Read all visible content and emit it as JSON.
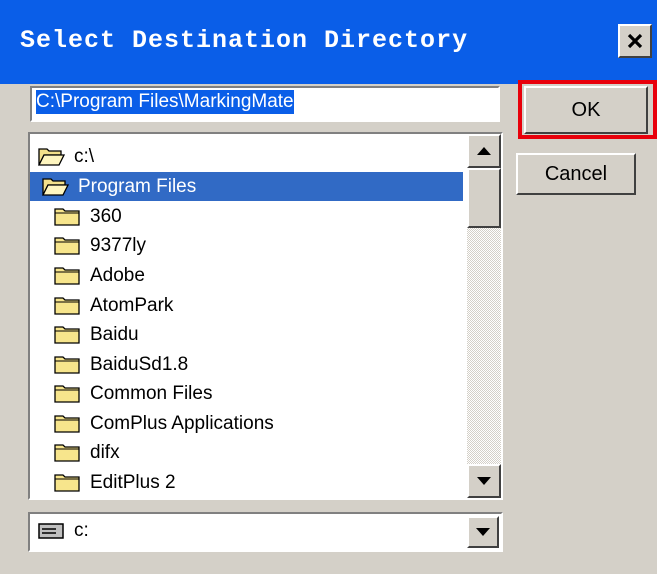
{
  "dialog": {
    "title": "Select Destination Directory",
    "close_glyph": "✕",
    "path_value": "C:\\Program Files\\MarkingMate",
    "ok_label": "OK",
    "cancel_label": "Cancel"
  },
  "tree": {
    "items": [
      {
        "label": "c:\\",
        "icon": "open-folder-icon"
      },
      {
        "label": "Program Files",
        "icon": "open-folder-icon",
        "selected": true
      },
      {
        "label": "360",
        "icon": "folder-icon"
      },
      {
        "label": "9377ly",
        "icon": "folder-icon"
      },
      {
        "label": "Adobe",
        "icon": "folder-icon"
      },
      {
        "label": "AtomPark",
        "icon": "folder-icon"
      },
      {
        "label": "Baidu",
        "icon": "folder-icon"
      },
      {
        "label": "BaiduSd1.8",
        "icon": "folder-icon"
      },
      {
        "label": "Common Files",
        "icon": "folder-icon"
      },
      {
        "label": "ComPlus Applications",
        "icon": "folder-icon"
      },
      {
        "label": "difx",
        "icon": "folder-icon"
      },
      {
        "label": "EditPlus 2",
        "icon": "folder-icon"
      }
    ]
  },
  "drive": {
    "value": "c:",
    "icon": "drive-icon"
  },
  "colors": {
    "titlebar": "#0a5ee8",
    "selection": "#316ac5",
    "highlight_box": "#e8000b",
    "face": "#d4d0c8"
  }
}
